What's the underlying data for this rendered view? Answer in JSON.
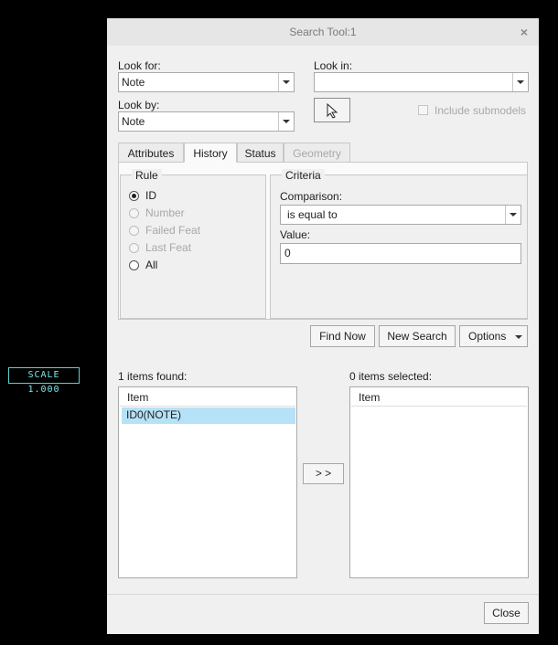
{
  "background_label": "SCALE 1.000",
  "dialog": {
    "title": "Search Tool:1",
    "close_glyph": "×",
    "look_for": {
      "label": "Look for:",
      "value": "Note"
    },
    "look_by": {
      "label": "Look by:",
      "value": "Note"
    },
    "look_in": {
      "label": "Look in:",
      "value": ""
    },
    "include_submodels": {
      "label": "Include submodels",
      "checked": false,
      "enabled": false
    },
    "tabs": [
      "Attributes",
      "History",
      "Status",
      "Geometry"
    ],
    "active_tab": "History",
    "rule": {
      "title": "Rule",
      "options": [
        {
          "label": "ID",
          "selected": true,
          "enabled": true
        },
        {
          "label": "Number",
          "selected": false,
          "enabled": false
        },
        {
          "label": "Failed Feat",
          "selected": false,
          "enabled": false
        },
        {
          "label": "Last Feat",
          "selected": false,
          "enabled": false
        },
        {
          "label": "All",
          "selected": false,
          "enabled": true
        }
      ]
    },
    "criteria": {
      "title": "Criteria",
      "comparison_label": "Comparison:",
      "comparison_value": "is equal to",
      "value_label": "Value:",
      "value": "0"
    },
    "buttons": {
      "find_now": "Find Now",
      "new_search": "New Search",
      "options": "Options",
      "transfer": "> >",
      "close": "Close"
    },
    "found": {
      "label": "1 items found:",
      "column": "Item",
      "items": [
        "ID0(NOTE)"
      ]
    },
    "selected": {
      "label": "0 items selected:",
      "column": "Item",
      "items": []
    }
  },
  "colors": {
    "selection": "#b6e2f7",
    "dialog_bg": "#f0f0f0",
    "scale_label": "#7ee8e8"
  }
}
